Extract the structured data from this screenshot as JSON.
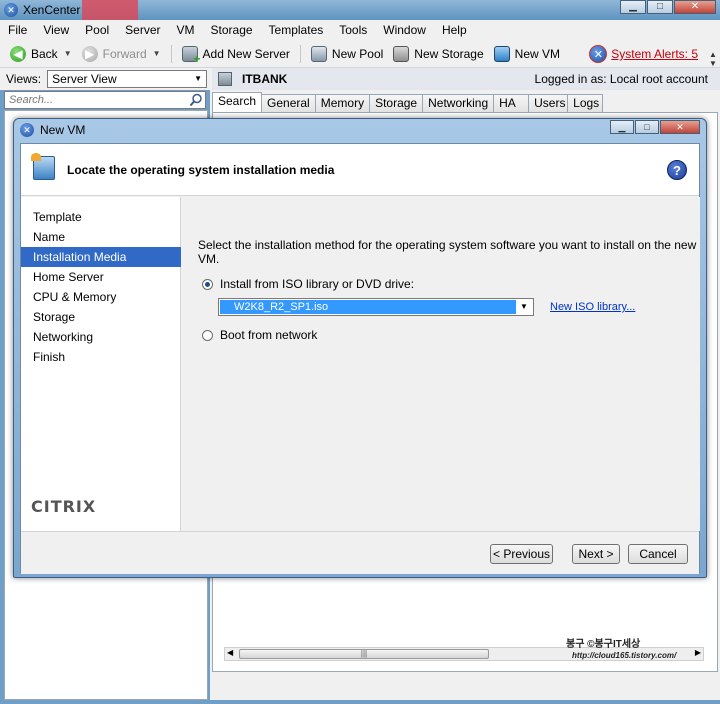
{
  "app": {
    "title": "XenCenter"
  },
  "menu": [
    "File",
    "View",
    "Pool",
    "Server",
    "VM",
    "Storage",
    "Templates",
    "Tools",
    "Window",
    "Help"
  ],
  "toolbar": {
    "back": "Back",
    "forward": "Forward",
    "add_server": "Add New Server",
    "new_pool": "New Pool",
    "new_storage": "New Storage",
    "new_vm": "New VM",
    "alerts": "System Alerts: 5"
  },
  "views": {
    "label": "Views:",
    "selected": "Server View",
    "search_placeholder": "Search..."
  },
  "resource": {
    "name": "ITBANK",
    "login": "Logged in as: Local root account"
  },
  "tabs": [
    "Search",
    "General",
    "Memory",
    "Storage",
    "Networking",
    "HA",
    "Users",
    "Logs"
  ],
  "dialog": {
    "title": "New VM",
    "header": "Locate the operating system installation media",
    "help": "?",
    "steps": [
      "Template",
      "Name",
      "Installation Media",
      "Home Server",
      "CPU & Memory",
      "Storage",
      "Networking",
      "Finish"
    ],
    "active_step": 2,
    "brand": "CITRIX",
    "instruction": "Select the installation method for the operating system software you want to install on the new VM.",
    "option_iso": "Install from ISO library or DVD drive:",
    "iso_selected": "W2K8_R2_SP1.iso",
    "new_iso_link": "New ISO library...",
    "option_network": "Boot from network",
    "btn_previous": "< Previous",
    "btn_next": "Next >",
    "btn_cancel": "Cancel"
  },
  "watermark": {
    "text": "봉구 ©봉구IT세상",
    "url": "http://cloud165.tistory.com/"
  },
  "colors": {
    "selection": "#3169c6",
    "iso_highlight": "#3399ff",
    "alert": "#c3000b"
  }
}
